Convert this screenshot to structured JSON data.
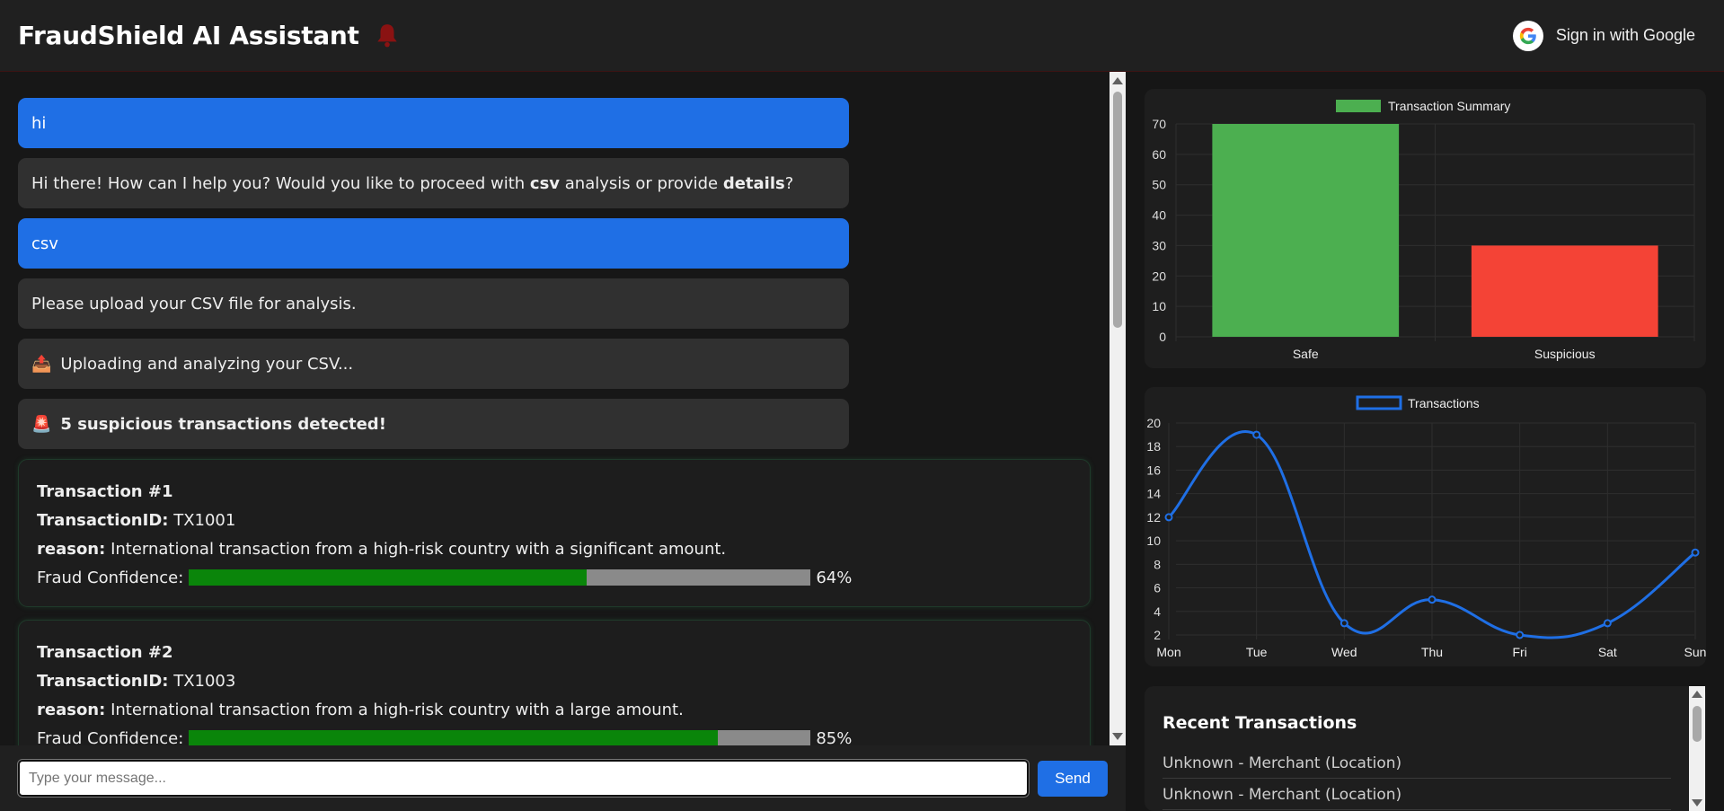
{
  "header": {
    "title": "FraudShield AI Assistant",
    "bell_icon": "bell-icon",
    "signin_label": "Sign in with Google",
    "google_icon": "google-g-icon"
  },
  "messages": [
    {
      "role": "user",
      "parts": [
        {
          "t": "hi"
        }
      ]
    },
    {
      "role": "bot",
      "parts": [
        {
          "t": "Hi there! How can I help you? Would you like to proceed with "
        },
        {
          "t": "csv",
          "b": true
        },
        {
          "t": " analysis or provide "
        },
        {
          "t": "details",
          "b": true
        },
        {
          "t": "?"
        }
      ]
    },
    {
      "role": "user",
      "parts": [
        {
          "t": "csv"
        }
      ]
    },
    {
      "role": "bot",
      "parts": [
        {
          "t": "Please upload your CSV file for analysis."
        }
      ]
    },
    {
      "role": "bot",
      "emoji": "📤",
      "parts": [
        {
          "t": "Uploading and analyzing your CSV..."
        }
      ]
    },
    {
      "role": "bot",
      "emoji": "🚨",
      "parts": [
        {
          "t": "5 suspicious transactions detected!",
          "b": true
        }
      ]
    }
  ],
  "transactions": [
    {
      "title": "Transaction #1",
      "id_label": "TransactionID:",
      "id": "TX1001",
      "reason_label": "reason:",
      "reason": "International transaction from a high-risk country with a significant amount.",
      "confidence_label": "Fraud Confidence:",
      "confidence": 64,
      "confidence_text": "64%"
    },
    {
      "title": "Transaction #2",
      "id_label": "TransactionID:",
      "id": "TX1003",
      "reason_label": "reason:",
      "reason": "International transaction from a high-risk country with a large amount.",
      "confidence_label": "Fraud Confidence:",
      "confidence": 85,
      "confidence_text": "85%"
    }
  ],
  "input": {
    "placeholder": "Type your message...",
    "value": "",
    "send_label": "Send"
  },
  "colors": {
    "accent": "#1f6fe5",
    "safe": "#4caf50",
    "suspicious": "#f44336",
    "confidence_fill": "#0a850a"
  },
  "chart_data": [
    {
      "type": "bar",
      "legend": "Transaction Summary",
      "categories": [
        "Safe",
        "Suspicious"
      ],
      "values": [
        70,
        30
      ],
      "colors": [
        "#4caf50",
        "#f44336"
      ],
      "ylim": [
        0,
        70
      ],
      "yticks": [
        0,
        10,
        20,
        30,
        40,
        50,
        60,
        70
      ],
      "grid": true,
      "legend_position": "top"
    },
    {
      "type": "line",
      "legend": "Transactions",
      "categories": [
        "Mon",
        "Tue",
        "Wed",
        "Thu",
        "Fri",
        "Sat",
        "Sun"
      ],
      "values": [
        12,
        19,
        3,
        5,
        2,
        3,
        9
      ],
      "color": "#1f6fe5",
      "ylim": [
        2,
        20
      ],
      "yticks": [
        2,
        4,
        6,
        8,
        10,
        12,
        14,
        16,
        18,
        20
      ],
      "grid": true,
      "legend_position": "top"
    }
  ],
  "recent": {
    "title": "Recent Transactions",
    "items": [
      "Unknown - Merchant (Location)",
      "Unknown - Merchant (Location)"
    ]
  }
}
